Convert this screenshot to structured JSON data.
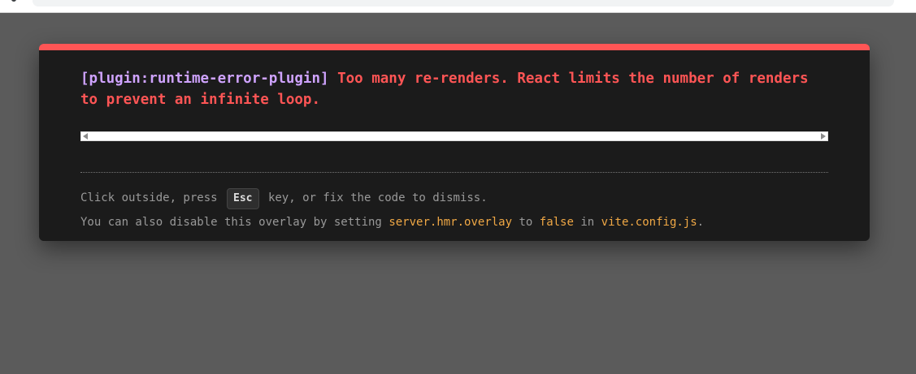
{
  "browser": {
    "url_fragment": "...p... ..."
  },
  "error": {
    "plugin_tag": "[plugin:runtime-error-plugin]",
    "message": "Too many re-renders. React limits the number of renders to prevent an infinite loop."
  },
  "tip1": {
    "before": "Click outside, press",
    "key": "Esc",
    "after": "key, or fix the code to dismiss."
  },
  "tip2": {
    "prefix": "You can also disable this overlay by setting",
    "setting": "server.hmr.overlay",
    "to": "to",
    "value": "false",
    "in": "in",
    "file": "vite.config.js",
    "period": "."
  },
  "colors": {
    "accent_red": "#ff5555",
    "plugin_purple": "#cfa3ff",
    "code_orange": "#f0a845",
    "backdrop": "#5b5b5b",
    "window_bg": "#1b1b1b"
  }
}
